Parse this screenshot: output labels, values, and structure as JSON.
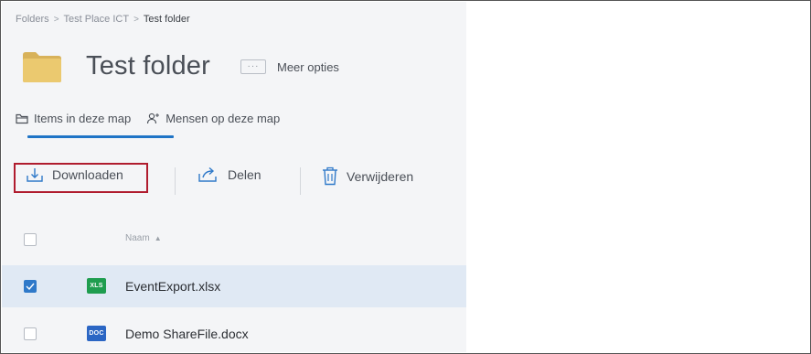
{
  "breadcrumb": {
    "items": [
      "Folders",
      "Test Place ICT",
      "Test folder"
    ],
    "separator": ">"
  },
  "header": {
    "title": "Test folder",
    "more_options_label": "Meer opties",
    "more_options_icon": "···"
  },
  "tabs": [
    {
      "label": "Items in deze map",
      "icon": "folder-outline-icon",
      "active": true
    },
    {
      "label": "Mensen op deze map",
      "icon": "person-add-icon",
      "active": false
    }
  ],
  "toolbar": {
    "download_label": "Downloaden",
    "share_label": "Delen",
    "delete_label": "Verwijderen",
    "highlighted": "download"
  },
  "list": {
    "column_name": "Naam",
    "sort_indicator": "▲",
    "rows": [
      {
        "badge": "XLS",
        "name": "EventExport.xlsx",
        "checked": true
      },
      {
        "badge": "DOC",
        "name": "Demo ShareFile.docx",
        "checked": false
      }
    ]
  },
  "colors": {
    "accent": "#1f74c6",
    "checkbox_checked": "#2f79c9",
    "selected_row": "#e0e9f4",
    "highlight_border": "#b01c2e",
    "folder": "#e9c46a",
    "xls_badge": "#1f9d4f",
    "doc_badge": "#2b66c4"
  }
}
